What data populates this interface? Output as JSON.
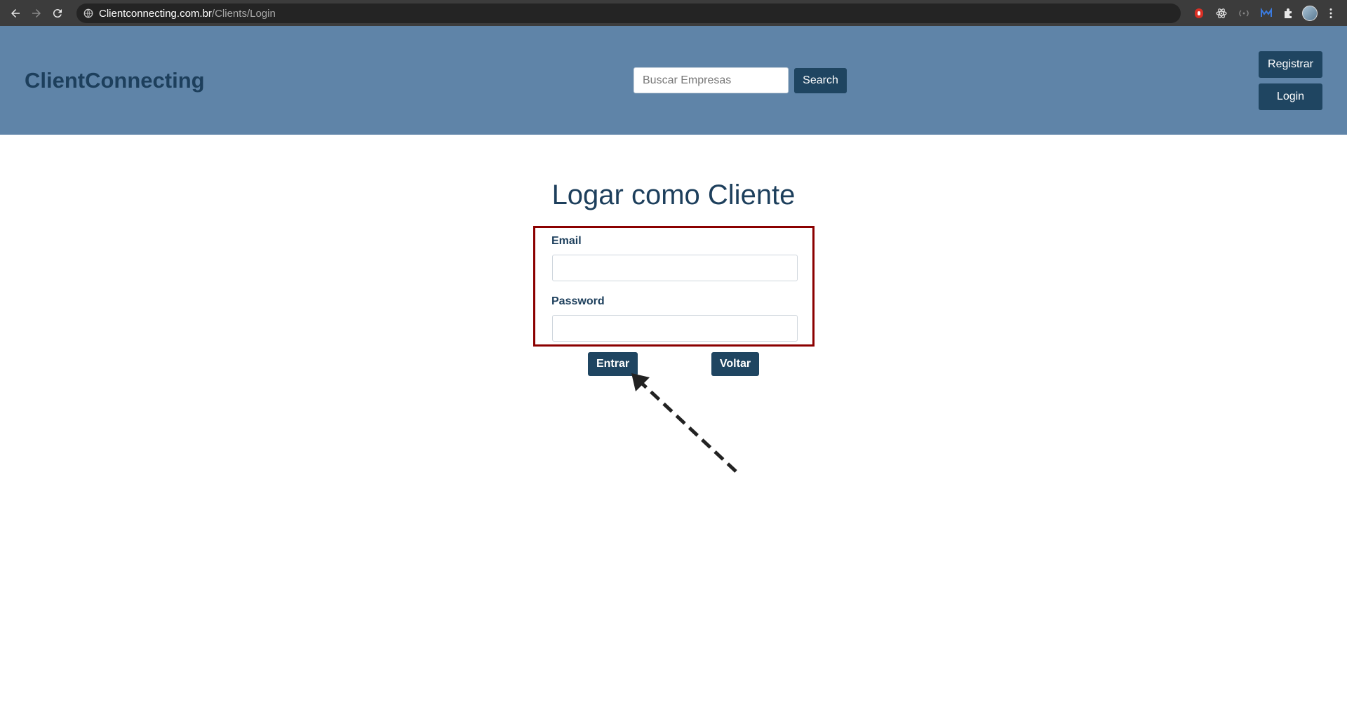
{
  "browser": {
    "url_domain": "Clientconnecting.com.br",
    "url_path": "/Clients/Login"
  },
  "header": {
    "brand": "ClientConnecting",
    "search_placeholder": "Buscar Empresas",
    "search_label": "Search",
    "register_label": "Registrar",
    "login_label": "Login"
  },
  "main": {
    "title": "Logar como Cliente",
    "email_label": "Email",
    "password_label": "Password",
    "enter_label": "Entrar",
    "back_label": "Voltar"
  },
  "colors": {
    "header_bg": "#5f84a8",
    "brand": "#1d3f5c",
    "button_bg": "#1f4561",
    "highlight_border": "#8b0000"
  }
}
